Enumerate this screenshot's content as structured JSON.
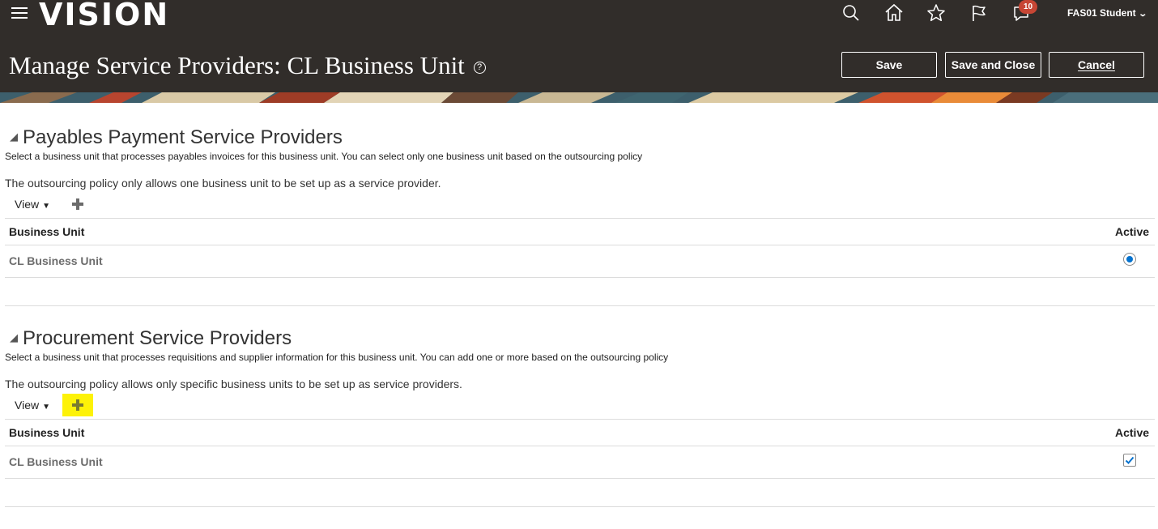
{
  "header": {
    "logo": "VISION",
    "notification_count": "10",
    "user_name": "FAS01 Student",
    "icons": [
      "menu-icon",
      "search-icon",
      "home-icon",
      "star-icon",
      "flag-icon",
      "notification-bell-icon"
    ],
    "page_title": "Manage Service Providers: CL Business Unit",
    "help_symbol": "?",
    "buttons": {
      "save": "Save",
      "save_close": "Save and Close",
      "cancel": "Cancel"
    }
  },
  "colors": {
    "header_bg": "#312d2a",
    "badge": "#c74634",
    "selection_blue": "#0572ce",
    "highlight": "#fdf208"
  },
  "payables": {
    "title": "Payables Payment Service Providers",
    "description": "Select a business unit that processes payables invoices for this business unit. You can select only one business unit based on the outsourcing policy",
    "policy": "The outsourcing policy only allows one business unit to be set up as a service provider.",
    "view_label": "View",
    "columns": [
      "Business Unit",
      "Active"
    ],
    "rows": [
      {
        "business_unit": "CL Business Unit",
        "active": true
      }
    ]
  },
  "procurement": {
    "title": "Procurement Service Providers",
    "description": "Select a business unit that processes requisitions and supplier information for this business unit. You can add one or more based on the outsourcing policy",
    "policy": "The outsourcing policy allows only specific business units to be set up as service providers.",
    "view_label": "View",
    "columns": [
      "Business Unit",
      "Active"
    ],
    "rows": [
      {
        "business_unit": "CL Business Unit",
        "active": true
      }
    ]
  }
}
